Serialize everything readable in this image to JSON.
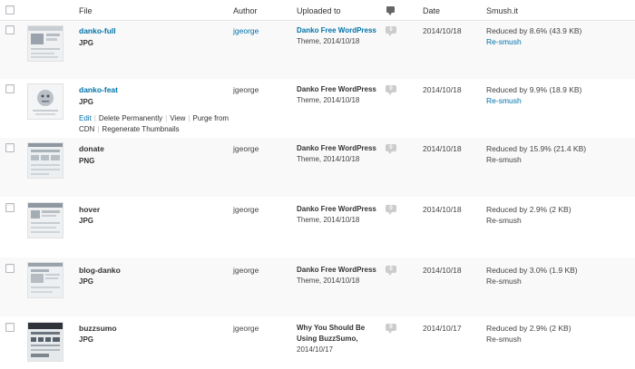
{
  "columns": {
    "file": "File",
    "author": "Author",
    "uploaded_to": "Uploaded to",
    "date": "Date",
    "smush": "Smush.it"
  },
  "rows": [
    {
      "name": "danko-full",
      "type": "JPG",
      "author": "jgeorge",
      "uploaded_title": "Danko Free WordPress",
      "uploaded_meta": "Theme, 2014/10/18",
      "comments": "0",
      "date": "2014/10/18",
      "smush_status": "Reduced by 8.6% (43.9 KB)",
      "resmush": "Re-smush"
    },
    {
      "name": "danko-feat",
      "type": "JPG",
      "author": "jgeorge",
      "uploaded_title": "Danko Free WordPress",
      "uploaded_meta": "Theme, 2014/10/18",
      "comments": "0",
      "date": "2014/10/18",
      "smush_status": "Reduced by 9.9% (18.9 KB)",
      "resmush": "Re-smush",
      "row_actions": {
        "edit": "Edit",
        "delete": "Delete Permanently",
        "view": "View",
        "purge": "Purge from CDN",
        "regenerate": "Regenerate Thumbnails"
      }
    },
    {
      "name": "donate",
      "type": "PNG",
      "author": "jgeorge",
      "uploaded_title": "Danko Free WordPress",
      "uploaded_meta": "Theme, 2014/10/18",
      "comments": "0",
      "date": "2014/10/18",
      "smush_status": "Reduced by 15.9% (21.4 KB)",
      "resmush": "Re-smush"
    },
    {
      "name": "hover",
      "type": "JPG",
      "author": "jgeorge",
      "uploaded_title": "Danko Free WordPress",
      "uploaded_meta": "Theme, 2014/10/18",
      "comments": "0",
      "date": "2014/10/18",
      "smush_status": "Reduced by 2.9% (2 KB)",
      "resmush": "Re-smush"
    },
    {
      "name": "blog-danko",
      "type": "JPG",
      "author": "jgeorge",
      "uploaded_title": "Danko Free WordPress",
      "uploaded_meta": "Theme, 2014/10/18",
      "comments": "0",
      "date": "2014/10/18",
      "smush_status": "Reduced by 3.0% (1.9 KB)",
      "resmush": "Re-smush"
    },
    {
      "name": "buzzsumo",
      "type": "JPG",
      "author": "jgeorge",
      "uploaded_title": "Why You Should Be",
      "uploaded_title_2": "Using BuzzSumo,",
      "uploaded_meta": "2014/10/17",
      "comments": "0",
      "date": "2014/10/17",
      "smush_status": "Reduced by 2.9% (2 KB)",
      "resmush": "Re-smush"
    }
  ],
  "colors": {
    "link": "#0073aa",
    "delete": "#a00000",
    "stripe": "#f9f9f9",
    "bubble": "#cccccc"
  }
}
